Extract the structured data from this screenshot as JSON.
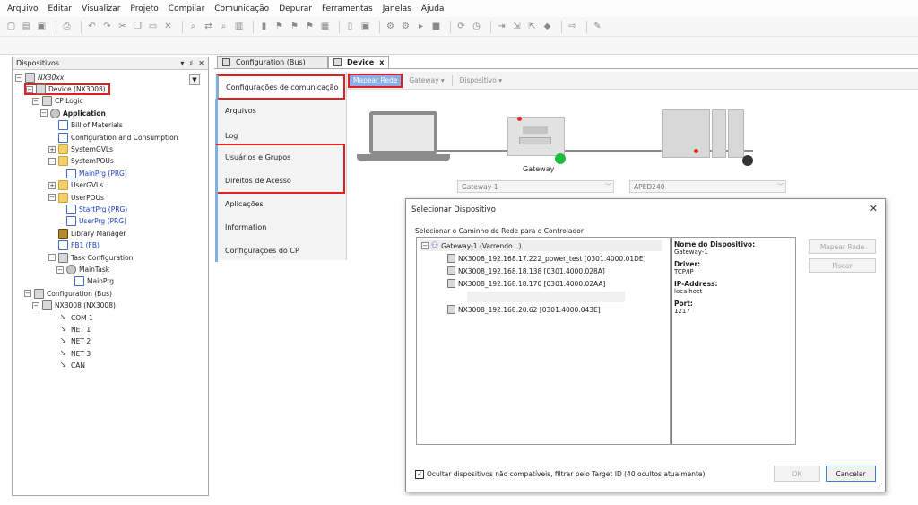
{
  "menu": [
    "Arquivo",
    "Editar",
    "Visualizar",
    "Projeto",
    "Compilar",
    "Comunicação",
    "Depurar",
    "Ferramentas",
    "Janelas",
    "Ajuda"
  ],
  "devices_panel": {
    "title": "Dispositivos",
    "controls": [
      "▾",
      "♯",
      "✕"
    ],
    "root_value": "NX30xx",
    "tree": [
      {
        "label": "Device (NX3008)",
        "level": 1,
        "expander": "−",
        "icon": "dev"
      },
      {
        "label": "CP Logic",
        "level": 2,
        "expander": "−",
        "icon": "dev"
      },
      {
        "label": "Application",
        "level": 3,
        "expander": "−",
        "icon": "gear"
      },
      {
        "label": "Bill of Materials",
        "level": 4,
        "expander": "",
        "icon": "doc"
      },
      {
        "label": "Configuration and Consumption",
        "level": 4,
        "expander": "",
        "icon": "doc"
      },
      {
        "label": "SystemGVLs",
        "level": 4,
        "expander": "+",
        "icon": "folder"
      },
      {
        "label": "SystemPOUs",
        "level": 4,
        "expander": "−",
        "icon": "folder"
      },
      {
        "label": "MainPrg (PRG)",
        "level": 5,
        "expander": "",
        "icon": "doc"
      },
      {
        "label": "UserGVLs",
        "level": 4,
        "expander": "+",
        "icon": "folder"
      },
      {
        "label": "UserPOUs",
        "level": 4,
        "expander": "−",
        "icon": "folder"
      },
      {
        "label": "StartPrg (PRG)",
        "level": 5,
        "expander": "",
        "icon": "doc"
      },
      {
        "label": "UserPrg (PRG)",
        "level": 5,
        "expander": "",
        "icon": "doc"
      },
      {
        "label": "Library Manager",
        "level": 4,
        "expander": "",
        "icon": "lib"
      },
      {
        "label": "FB1 (FB)",
        "level": 4,
        "expander": "",
        "icon": "doc"
      },
      {
        "label": "Task Configuration",
        "level": 4,
        "expander": "−",
        "icon": "dev"
      },
      {
        "label": "MainTask",
        "level": 5,
        "expander": "−",
        "icon": "gear"
      },
      {
        "label": "MainPrg",
        "level": 6,
        "expander": "",
        "icon": "doc"
      },
      {
        "label": "Configuration (Bus)",
        "level": 1,
        "expander": "−",
        "icon": "dev"
      },
      {
        "label": "NX3008 (NX3008)",
        "level": 2,
        "expander": "−",
        "icon": "dev"
      },
      {
        "label": "COM 1",
        "level": 4,
        "expander": "",
        "icon": "net"
      },
      {
        "label": "NET 1",
        "level": 4,
        "expander": "",
        "icon": "net"
      },
      {
        "label": "NET 2",
        "level": 4,
        "expander": "",
        "icon": "net"
      },
      {
        "label": "NET 3",
        "level": 4,
        "expander": "",
        "icon": "net"
      },
      {
        "label": "CAN",
        "level": 4,
        "expander": "",
        "icon": "net"
      }
    ]
  },
  "editor_tabs": [
    {
      "label": "Configuration (Bus)"
    },
    {
      "label": "Device",
      "close": "x"
    }
  ],
  "side_tabs": [
    "Configurações de comunicação",
    "Arquivos",
    "Log",
    "Usuários e Grupos",
    "Direitos de Acesso",
    "Aplicações",
    "Information",
    "Configurações do CP"
  ],
  "subbar": {
    "scan": "Mapear Rede",
    "gateway": "Gateway ▾",
    "device": "Dispositivo ▾"
  },
  "diagram": {
    "gateway_label": "Gateway",
    "gateway_combo": "Gateway-1",
    "device_combo": "APED240",
    "combo_arrow": "﹀"
  },
  "dialog": {
    "title": "Selecionar Dispositivo",
    "close": "✕",
    "subtitle": "Selecionar o Caminho de Rede para o Controlador",
    "gateway_node": "Gateway-1 (Varrendo...)",
    "devices": [
      "NX3008_192.168.17.222_power_test [0301.4000.01DE]",
      "NX3008_192.168.18.138 [0301.4000.028A]",
      "NX3008_192.168.18.170 [0301.4000.02AA]",
      "NX3008_192.168.20.62 [0301.4000.043E]"
    ],
    "info": {
      "name_label": "Nome do Dispositivo:",
      "name_value": "Gateway-1",
      "driver_label": "Driver:",
      "driver_value": "TCP/IP",
      "ip_label": "IP-Address:",
      "ip_value": "localhost",
      "port_label": "Port:",
      "port_value": "1217"
    },
    "buttons": {
      "scan": "Mapear Rede",
      "blink": "Piscar",
      "ok": "OK",
      "cancel": "Cancelar"
    },
    "checkbox": {
      "checked_mark": "✓",
      "label": "Ocultar dispositivos não compatíveis, filtrar pelo Target ID  (40 ocultos atualmente)"
    }
  },
  "colors": {
    "highlight_box": "#e02020",
    "accent": "#8aaee6",
    "status_green": "#1dbf3a"
  }
}
